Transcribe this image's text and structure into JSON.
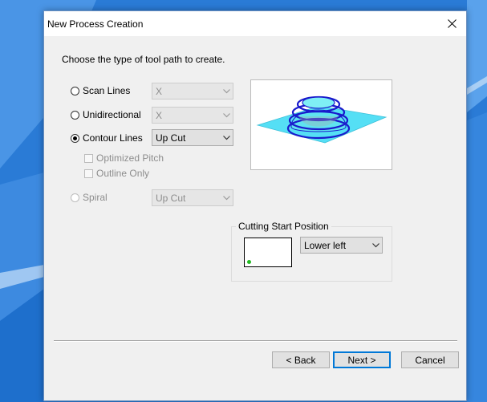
{
  "dialog": {
    "title": "New Process Creation",
    "prompt": "Choose the type of tool path to create."
  },
  "options": {
    "scan_lines": {
      "label": "Scan Lines",
      "selected": false,
      "enabled": true,
      "combo_value": "X",
      "combo_enabled": false
    },
    "unidirectional": {
      "label": "Unidirectional",
      "selected": false,
      "enabled": true,
      "combo_value": "X",
      "combo_enabled": false
    },
    "contour_lines": {
      "label": "Contour Lines",
      "selected": true,
      "enabled": true,
      "combo_value": "Up Cut",
      "combo_enabled": true
    },
    "optimized_pitch": {
      "label": "Optimized Pitch",
      "checked": false,
      "enabled": false
    },
    "outline_only": {
      "label": "Outline Only",
      "checked": false,
      "enabled": false
    },
    "spiral": {
      "label": "Spiral",
      "selected": false,
      "enabled": false,
      "combo_value": "Up Cut",
      "combo_enabled": false
    }
  },
  "cutting_start": {
    "label": "Cutting Start Position",
    "value": "Lower left"
  },
  "buttons": {
    "back": "< Back",
    "next": "Next >",
    "cancel": "Cancel"
  },
  "colors": {
    "background_blue": "#2f7fd9",
    "preview_plane": "#55dff5",
    "preview_contours": "#1a1acc",
    "start_dot": "#22bb22"
  }
}
